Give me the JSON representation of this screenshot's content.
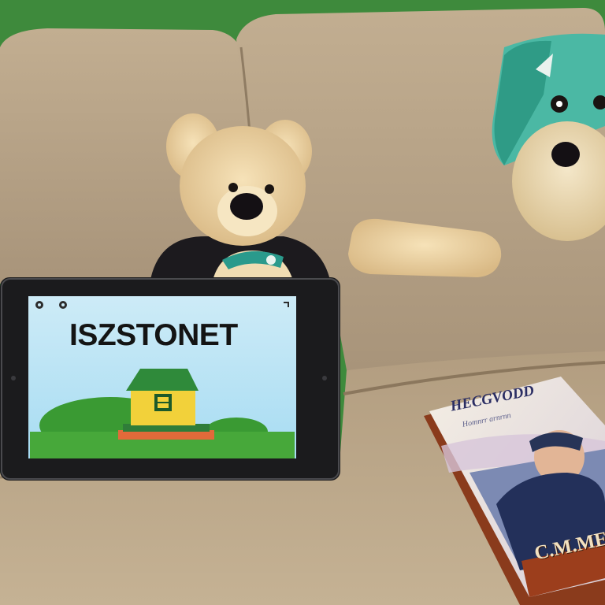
{
  "scene": {
    "colors": {
      "wall": "#3e8a3c",
      "couch": "#b8a58a",
      "couch_dark": "#9c8a70",
      "plush_fur": "#e9cf9e",
      "plush_scarf": "#2a9a8c",
      "tablet_frame": "#1b1b1d",
      "screen_sky": "#b9e3f6",
      "screen_grass": "#47a83a",
      "book_spine": "#8a3b1c"
    },
    "tablet": {
      "screen_title": "ISZSTONET"
    },
    "book": {
      "title": "HECGVODD",
      "subtitle": "Homnrr arnrnn",
      "author": "C.M.ME"
    },
    "icons": [
      "teddy-bear-plush",
      "dinosaur-plush",
      "tablet-device",
      "house-illustration",
      "book"
    ]
  }
}
